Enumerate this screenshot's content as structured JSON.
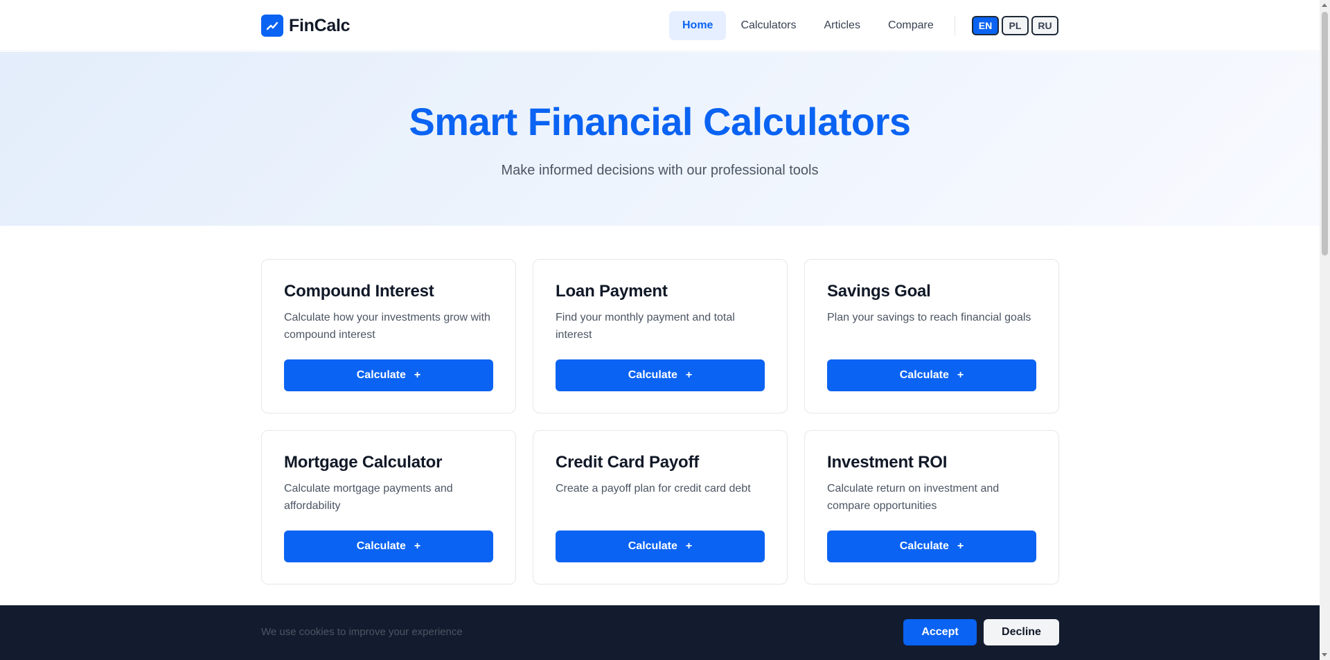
{
  "brand": {
    "name": "FinCalc",
    "icon": "trend-up-icon",
    "accent": "#0a63f2"
  },
  "nav": {
    "items": [
      {
        "label": "Home",
        "active": true
      },
      {
        "label": "Calculators",
        "active": false
      },
      {
        "label": "Articles",
        "active": false
      },
      {
        "label": "Compare",
        "active": false
      }
    ]
  },
  "languages": [
    {
      "code": "EN",
      "active": true
    },
    {
      "code": "PL",
      "active": false
    },
    {
      "code": "RU",
      "active": false
    }
  ],
  "hero": {
    "title": "Smart Financial Calculators",
    "subtitle": "Make informed decisions with our professional tools"
  },
  "cards": [
    {
      "title": "Compound Interest",
      "description": "Calculate how your investments grow with compound interest",
      "button": "Calculate",
      "button_icon": "plus-icon"
    },
    {
      "title": "Loan Payment",
      "description": "Find your monthly payment and total interest",
      "button": "Calculate",
      "button_icon": "plus-icon"
    },
    {
      "title": "Savings Goal",
      "description": "Plan your savings to reach financial goals",
      "button": "Calculate",
      "button_icon": "plus-icon"
    },
    {
      "title": "Mortgage Calculator",
      "description": "Calculate mortgage payments and affordability",
      "button": "Calculate",
      "button_icon": "plus-icon"
    },
    {
      "title": "Credit Card Payoff",
      "description": "Create a payoff plan for credit card debt",
      "button": "Calculate",
      "button_icon": "plus-icon"
    },
    {
      "title": "Investment ROI",
      "description": "Calculate return on investment and compare opportunities",
      "button": "Calculate",
      "button_icon": "plus-icon"
    }
  ],
  "cookie": {
    "message": "We use cookies to improve your experience",
    "accept": "Accept",
    "decline": "Decline"
  }
}
